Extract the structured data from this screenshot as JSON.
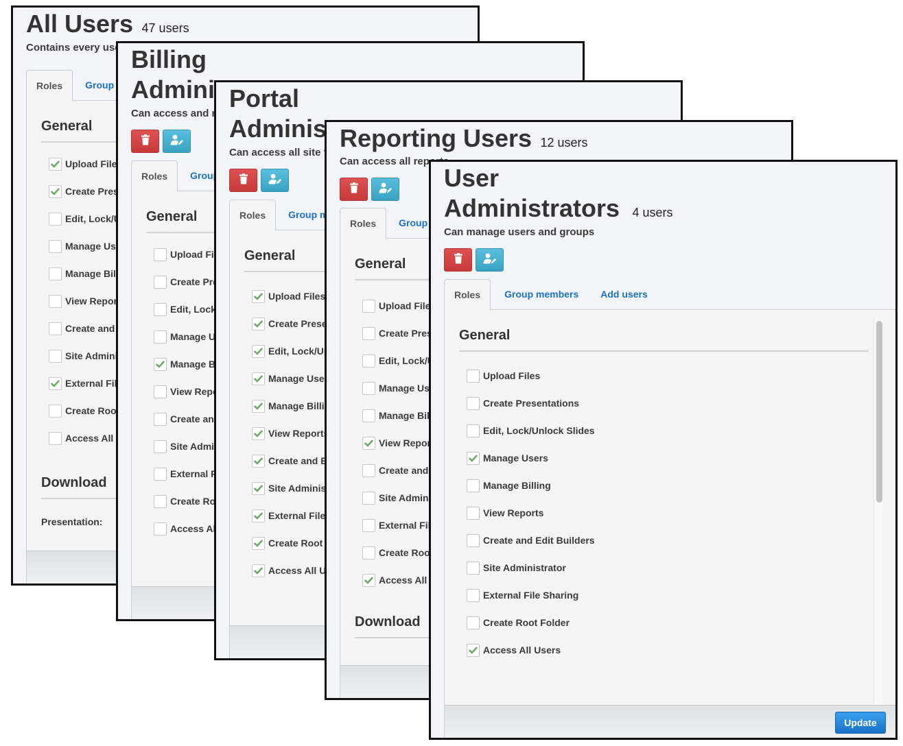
{
  "permission_labels": [
    "Upload Files",
    "Create Presentations",
    "Edit, Lock/Unlock Slides",
    "Manage Users",
    "Manage Billing",
    "View Reports",
    "Create and Edit Builders",
    "Site Administrator",
    "External File Sharing",
    "Create Root Folder",
    "Access All Users"
  ],
  "tabs": {
    "roles": "Roles",
    "group_members": "Group members",
    "add_users": "Add users"
  },
  "sections": {
    "general": "General",
    "download": "Download",
    "presentation_label": "Presentation:"
  },
  "icons": {
    "delete": "trash-icon",
    "edit_group": "user-edit-icon",
    "check": "checkmark-icon"
  },
  "colors": {
    "delete_button": "#d9534f",
    "edit_button": "#4bb1cf",
    "update_button": "#2a88dc",
    "tab_link": "#1a6fc9",
    "check": "#6aaa64"
  },
  "groups": [
    {
      "title_line1": "All Users",
      "title_line2": "",
      "count": "47 users",
      "description": "Contains every user",
      "checked": [
        true,
        true,
        false,
        false,
        false,
        false,
        false,
        false,
        true,
        false,
        false
      ]
    },
    {
      "title_line1": "Billing",
      "title_line2": "Administrators",
      "count": "",
      "description": "Can access and manage billing",
      "checked": [
        false,
        false,
        false,
        false,
        true,
        false,
        false,
        false,
        false,
        false,
        false
      ]
    },
    {
      "title_line1": "Portal",
      "title_line2": "Administrators",
      "count": "",
      "description": "Can access all site functions",
      "checked": [
        true,
        true,
        true,
        true,
        true,
        true,
        true,
        true,
        true,
        true,
        true
      ]
    },
    {
      "title_line1": "Reporting Users",
      "title_line2": "",
      "count": "12 users",
      "description": "Can access all reports",
      "checked": [
        false,
        false,
        false,
        false,
        false,
        true,
        false,
        false,
        false,
        false,
        true
      ]
    },
    {
      "title_line1": "User",
      "title_line2": "Administrators",
      "count": "4 users",
      "description": "Can manage users and groups",
      "checked": [
        false,
        false,
        false,
        true,
        false,
        false,
        false,
        false,
        false,
        false,
        true
      ]
    }
  ],
  "footer": {
    "update_label": "Update"
  }
}
